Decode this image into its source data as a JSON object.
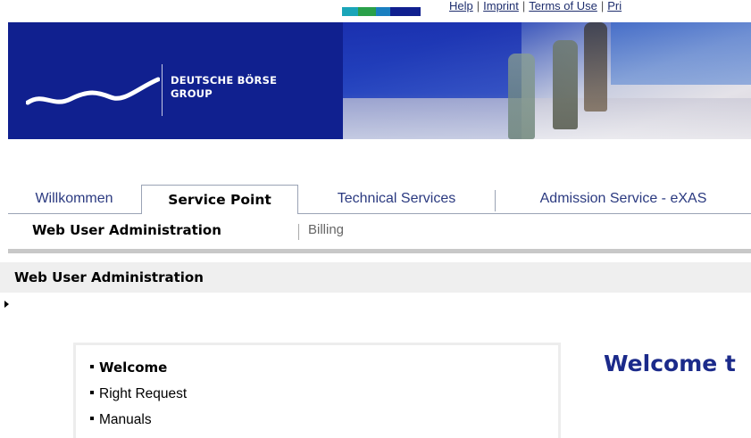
{
  "utility_links": [
    "Help",
    "Imprint",
    "Terms of Use",
    "Pri"
  ],
  "brand": {
    "line1": "DEUTSCHE BÖRSE",
    "line2": "GROUP",
    "color": "#10208f"
  },
  "tabs": [
    {
      "label": "Willkommen",
      "active": false
    },
    {
      "label": "Service Point",
      "active": true
    },
    {
      "label": "Technical Services",
      "active": false
    },
    {
      "label": "Admission Service - eXAS",
      "active": false
    }
  ],
  "subnav": {
    "active": "Web User Administration",
    "items": [
      "Billing"
    ]
  },
  "section": {
    "title": "Web User Administration"
  },
  "menu": {
    "items": [
      {
        "label": "Welcome",
        "active": true
      },
      {
        "label": "Right Request",
        "active": false
      },
      {
        "label": "Manuals",
        "active": false
      }
    ]
  },
  "main": {
    "heading": "Welcome t"
  },
  "colors": {
    "accent_blue": "#1b2a8a",
    "link_blue": "#1f2f6e",
    "tab_green": "#2aa04a",
    "tab_teal": "#1aa5b8",
    "tab_navy": "#10208f"
  },
  "icons": {
    "logo": "deutsche-boerse-wave-logo",
    "marker": "triangle-right-icon",
    "bullet": "square-bullet-icon"
  }
}
